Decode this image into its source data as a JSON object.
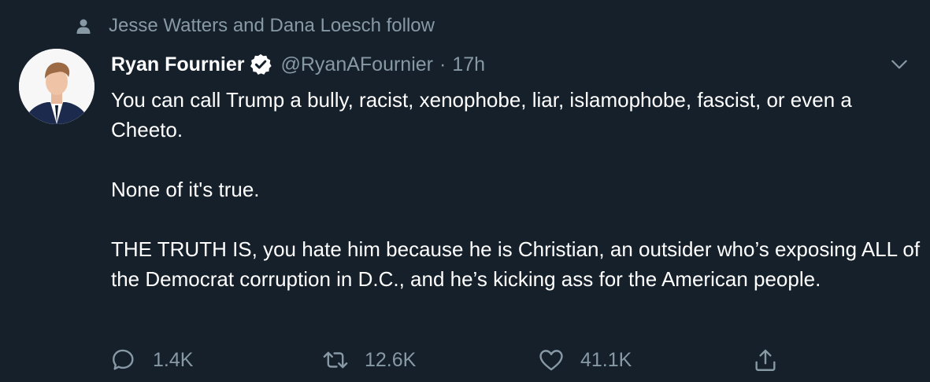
{
  "social_context": {
    "text": "Jesse Watters and Dana Loesch follow"
  },
  "author": {
    "name": "Ryan Fournier",
    "handle": "@RyanAFournier",
    "separator": "·",
    "time": "17h",
    "verified": true
  },
  "tweet": {
    "paragraphs": [
      "You can call Trump a bully, racist, xenophobe, liar, islamophobe, fascist, or even a Cheeto.",
      "None of it's true.",
      "THE TRUTH IS, you hate him because he is Christian, an outsider who’s exposing ALL of the Democrat corruption in D.C., and he’s kicking ass for the American people."
    ]
  },
  "actions": {
    "reply_count": "1.4K",
    "retweet_count": "12.6K",
    "like_count": "41.1K"
  },
  "icons": {
    "social": "person-icon",
    "verified": "verified-badge-icon",
    "menu": "chevron-down-icon",
    "reply": "reply-icon",
    "retweet": "retweet-icon",
    "like": "heart-icon",
    "share": "share-icon"
  },
  "colors": {
    "background": "#15202b",
    "text": "#ffffff",
    "secondary": "#8899a6",
    "verified_badge": "#ffffff"
  }
}
